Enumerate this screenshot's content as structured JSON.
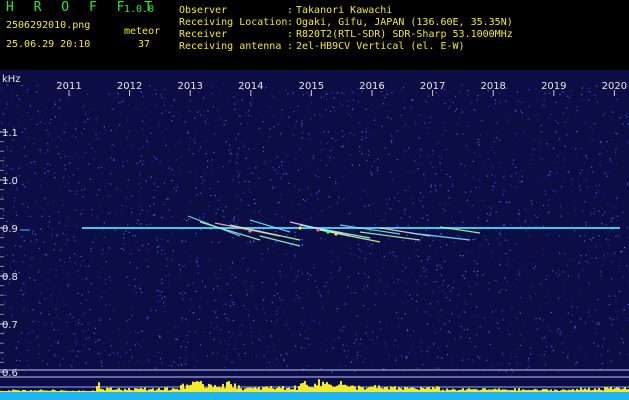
{
  "app": {
    "title": "H R O F F T",
    "version": "1.0.0",
    "filename": "2506292010.png",
    "datetime": "25.06.29 20:10",
    "meteor_label": "meteor",
    "meteor_count": "37"
  },
  "info": [
    {
      "label": "Observer",
      "sep": ":",
      "value": "Takanori Kawachi"
    },
    {
      "label": "Receiving Location",
      "sep": ":",
      "value": "Ogaki, Gifu, JAPAN (136.60E, 35.35N)"
    },
    {
      "label": "Receiver",
      "sep": ":",
      "value": "R820T2(RTL-SDR) SDR-Sharp 53.1000MHz"
    },
    {
      "label": "Receiving antenna",
      "sep": ":",
      "value": "2el-HB9CV Vertical (el. E-W)"
    }
  ],
  "chart_data": {
    "type": "heatmap",
    "y_unit": "kHz",
    "x_ticks": [
      "2011",
      "2012",
      "2013",
      "2014",
      "2015",
      "2016",
      "2017",
      "2018",
      "2019",
      "2020"
    ],
    "y_ticks": [
      "1.1",
      "1.0",
      "0.9",
      "0.8",
      "0.7",
      "0.6"
    ],
    "carrier_khz": 0.9,
    "colors": {
      "background": "#0d0d45",
      "carrier": "#3fc6e8",
      "bars": "#f2ea2a",
      "baseline": "#1fb6f0"
    }
  }
}
